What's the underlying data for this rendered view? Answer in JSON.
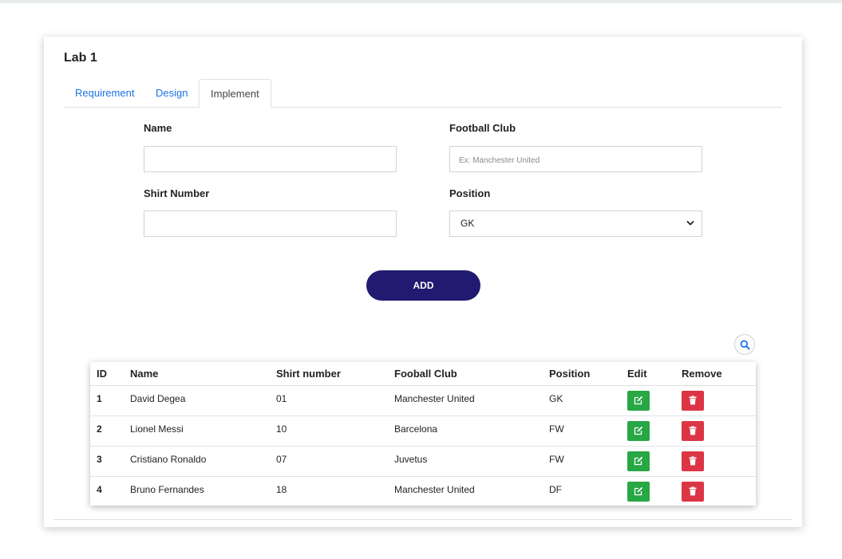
{
  "card": {
    "title": "Lab 1"
  },
  "tabs": [
    {
      "label": "Requirement",
      "active": false
    },
    {
      "label": "Design",
      "active": false
    },
    {
      "label": "Implement",
      "active": true
    }
  ],
  "form": {
    "name": {
      "label": "Name",
      "value": "",
      "placeholder": ""
    },
    "club": {
      "label": "Football Club",
      "value": "",
      "placeholder": "Ex: Manchester United"
    },
    "shirt": {
      "label": "Shirt Number",
      "value": "",
      "placeholder": ""
    },
    "position": {
      "label": "Position",
      "selected": "GK"
    },
    "add_label": "ADD"
  },
  "table": {
    "headers": {
      "id": "ID",
      "name": "Name",
      "shirt": "Shirt number",
      "club": "Fooball Club",
      "position": "Position",
      "edit": "Edit",
      "remove": "Remove"
    },
    "rows": [
      {
        "id": "1",
        "name": "David Degea",
        "shirt": "01",
        "club": "Manchester United",
        "position": "GK"
      },
      {
        "id": "2",
        "name": "Lionel Messi",
        "shirt": "10",
        "club": "Barcelona",
        "position": "FW"
      },
      {
        "id": "3",
        "name": "Cristiano Ronaldo",
        "shirt": "07",
        "club": "Juvetus",
        "position": "FW"
      },
      {
        "id": "4",
        "name": "Bruno Fernandes",
        "shirt": "18",
        "club": "Manchester United",
        "position": "DF"
      }
    ]
  },
  "icons": {
    "search": "search-icon",
    "edit": "edit-icon",
    "delete": "trash-icon",
    "select": "chevron-down-icon"
  },
  "colors": {
    "accent": "#201a70",
    "link": "#1a73e8",
    "edit": "#28a745",
    "delete": "#dc3545"
  }
}
